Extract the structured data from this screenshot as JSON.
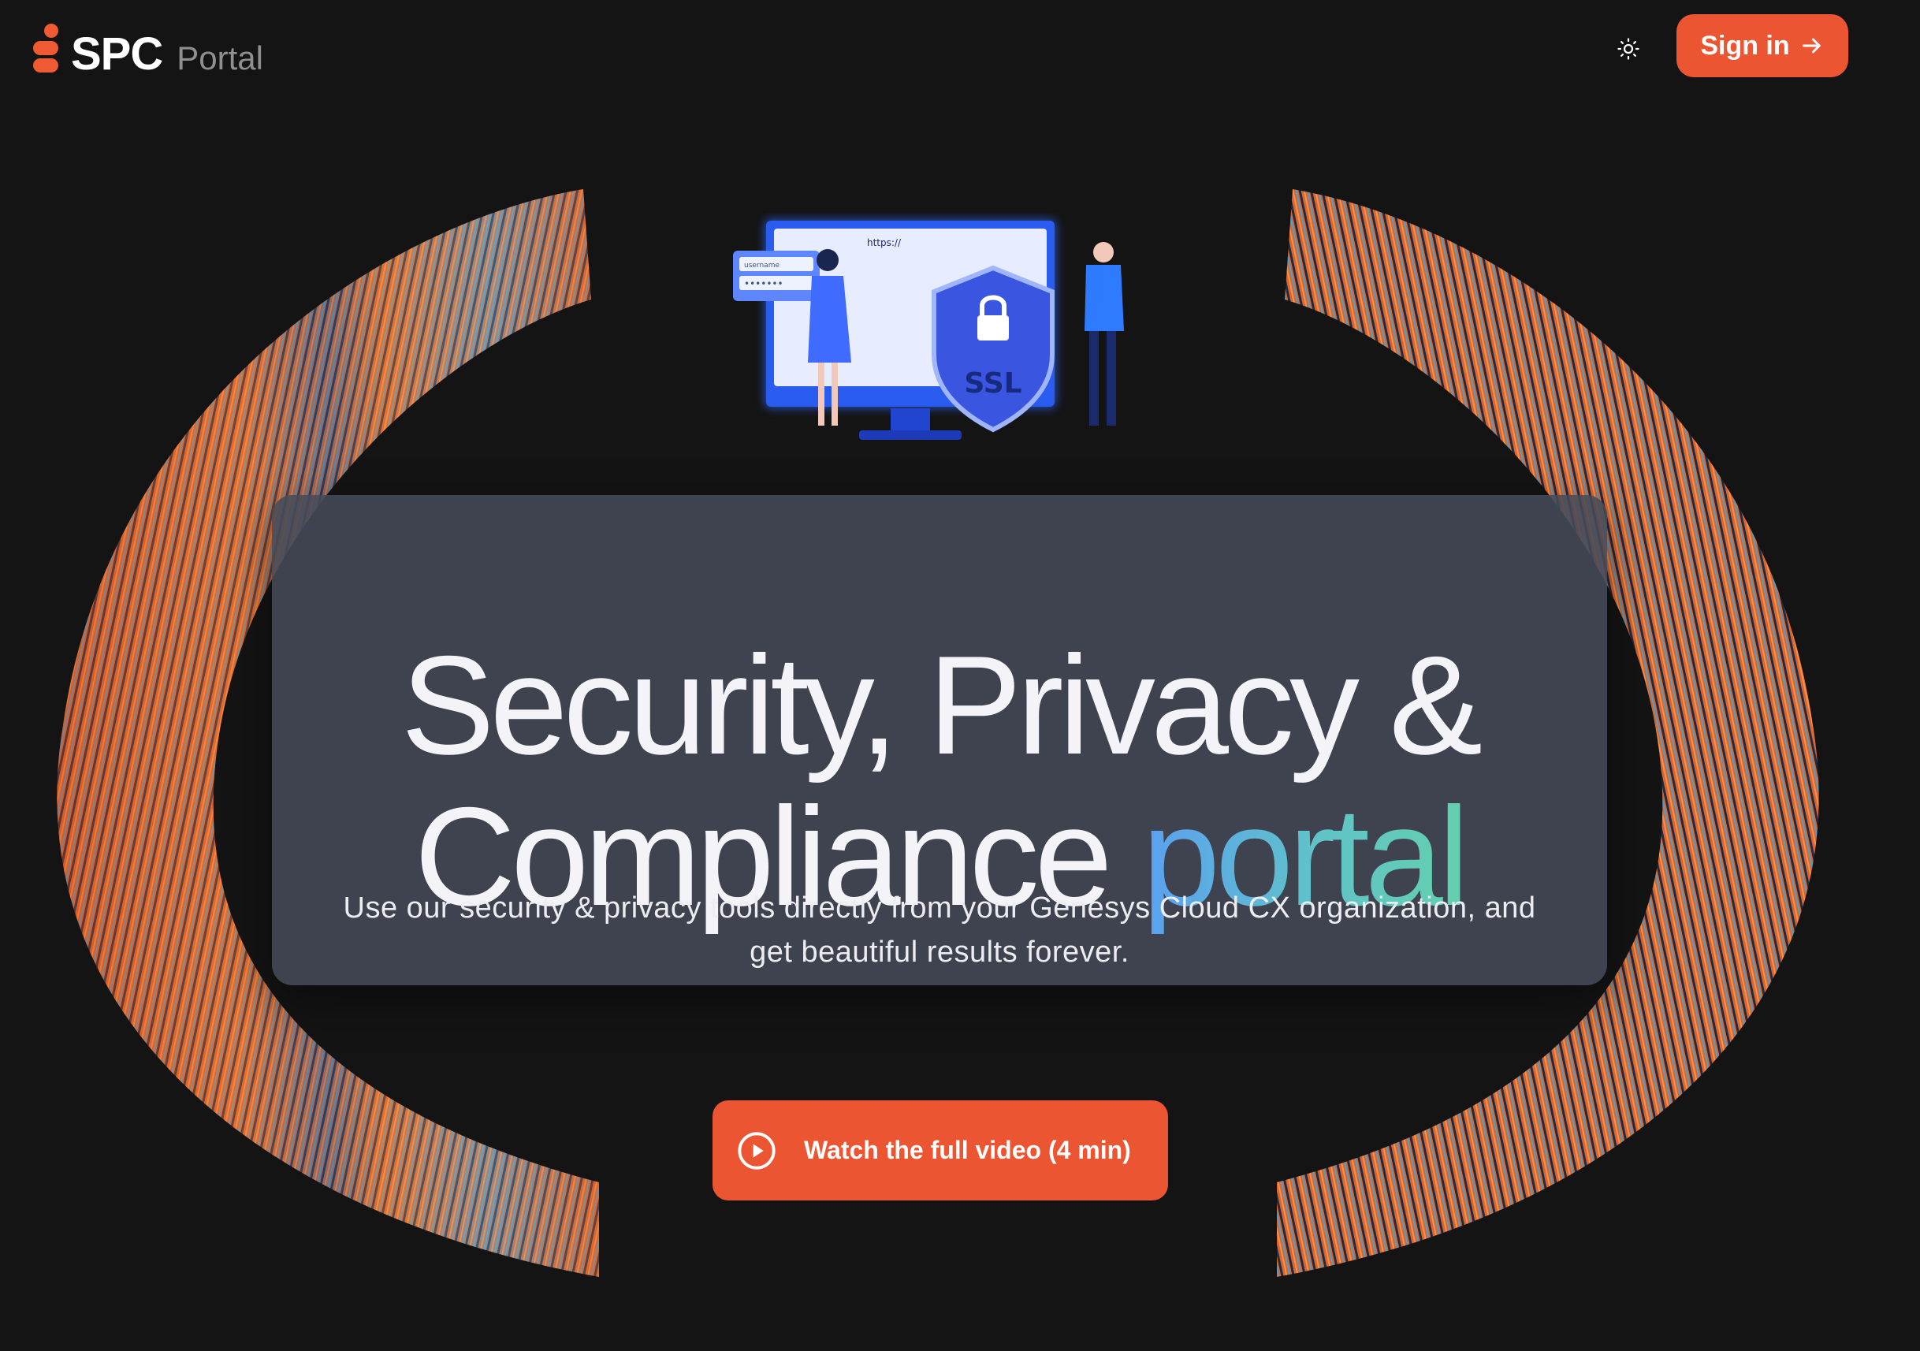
{
  "brand": {
    "name": "SPC",
    "sub": "Portal"
  },
  "header": {
    "theme_icon": "sun-icon",
    "signin_label": "Sign in",
    "signin_icon": "arrow-right-icon"
  },
  "illustration": {
    "url_text": "https://",
    "field_label": "username",
    "password_mask": "•••••••",
    "badge": "SSL"
  },
  "hero": {
    "title_line1": "Security, Privacy &",
    "title_line2_main": "Compliance",
    "title_line2_accent": "portal",
    "subtitle": "Use our security & privacy tools directly from your Genesys Cloud CX organization, and get beautiful results forever."
  },
  "cta": {
    "video_label": "Watch the full video (4 min)",
    "video_icon": "play-circle-icon"
  },
  "colors": {
    "accent": "#ec5531",
    "background": "#141414",
    "gradient_start": "#5aa0f0",
    "gradient_end": "#64d0ae"
  }
}
